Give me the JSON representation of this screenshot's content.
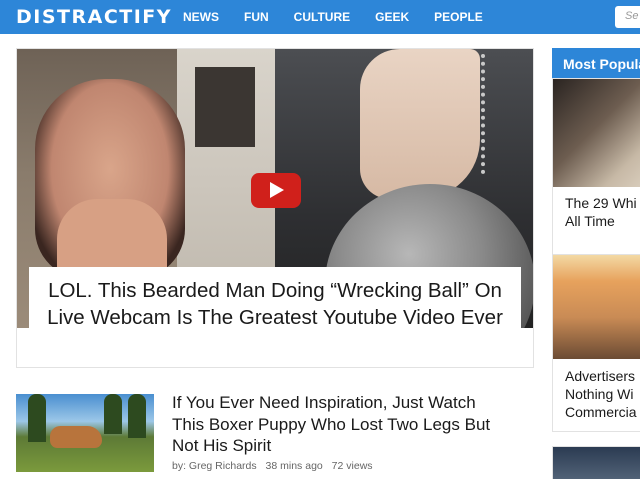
{
  "brand": {
    "logo": "DISTRACTIFY",
    "accent": "#2d86d8"
  },
  "nav": {
    "items": [
      "NEWS",
      "FUN",
      "CULTURE",
      "GEEK",
      "PEOPLE"
    ]
  },
  "search": {
    "placeholder": "Se"
  },
  "hero": {
    "title": "LOL. This Bearded Man Doing “Wrecking Ball” On Live Webcam Is The Greatest Youtube Video Ever",
    "play_icon": "play-icon"
  },
  "articles": [
    {
      "title": "If You Ever Need Inspiration, Just Watch This Boxer Puppy Who Lost Two Legs But Not His Spirit",
      "author": "by: Greg Richards",
      "time": "38 mins ago",
      "views": "72 views"
    }
  ],
  "sidebar": {
    "header": "Most Popula",
    "cards": [
      {
        "title_lines": [
          "The 29 Whi",
          "All Time"
        ]
      },
      {
        "title_lines": [
          "Advertisers",
          "Nothing Wi",
          "Commercia"
        ]
      }
    ]
  }
}
